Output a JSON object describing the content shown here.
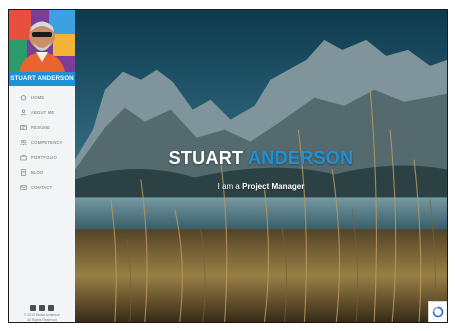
{
  "sidebar": {
    "name": "STUART ANDERSON",
    "nav": [
      {
        "label": "HOME",
        "icon": "home-icon"
      },
      {
        "label": "ABOUT ME",
        "icon": "user-icon"
      },
      {
        "label": "RESUME",
        "icon": "resume-icon"
      },
      {
        "label": "COMPETENCY",
        "icon": "people-icon"
      },
      {
        "label": "PORTFOLIO",
        "icon": "briefcase-icon"
      },
      {
        "label": "BLOG",
        "icon": "document-icon"
      },
      {
        "label": "CONTACT",
        "icon": "mail-icon"
      }
    ],
    "social_icons": [
      "facebook-icon",
      "linkedin-icon",
      "email-icon"
    ],
    "copyright_line1": "© 2019 Stuart Anderson",
    "copyright_line2": "All Rights Reserved"
  },
  "hero": {
    "first_name": "STUART",
    "last_name": "ANDERSON",
    "tagline_prefix": "I am a",
    "tagline_role": "Project Manager"
  },
  "colors": {
    "accent": "#1e90d6",
    "sidebar_bg": "#f3f4f5",
    "text_muted": "#6a6f74"
  }
}
